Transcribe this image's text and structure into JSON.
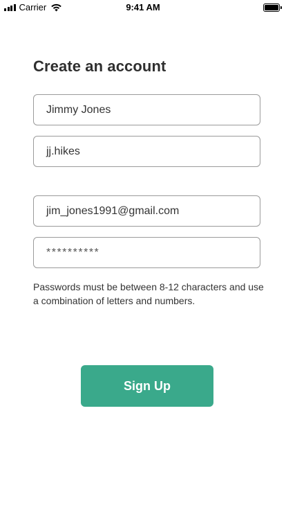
{
  "status_bar": {
    "carrier": "Carrier",
    "time": "9:41 AM",
    "icons": [
      "signal-icon",
      "wifi-icon",
      "battery-icon"
    ]
  },
  "form": {
    "title": "Create an account",
    "full_name": "Jimmy Jones",
    "username": "jj.hikes",
    "email": "jim_jones1991@gmail.com",
    "password": "**********",
    "password_hint": "Passwords must be between 8-12 characters and use a combination of letters and numbers.",
    "submit_label": "Sign Up"
  },
  "colors": {
    "accent": "#3aa98b",
    "field_border": "#9a9a9a",
    "text": "#2f2f2f"
  }
}
